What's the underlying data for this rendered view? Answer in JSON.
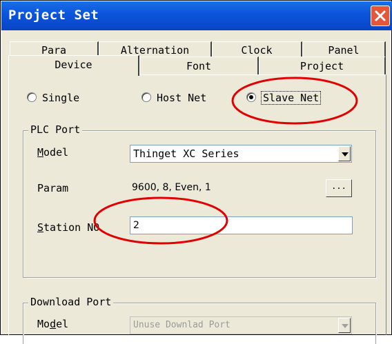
{
  "window": {
    "title": "Project Set",
    "close_icon": "close-icon"
  },
  "tabs_row1": [
    "Para",
    "Alternation",
    "Clock",
    "Panel"
  ],
  "tabs_row2": [
    "Device",
    "Font",
    "Project"
  ],
  "active_tab": "Device",
  "mode": {
    "options": [
      "Single",
      "Host Net",
      "Slave Net"
    ],
    "selected": "Slave Net"
  },
  "plc_port": {
    "group_title": "PLC Port",
    "model_label_u": "M",
    "model_label_rest": "odel",
    "model_value": "Thinget XC Series",
    "param_label": "Param",
    "param_value": "9600, 8, Even, 1",
    "param_button": "...",
    "station_label_u": "S",
    "station_label_rest": "tation NO",
    "station_value": "2"
  },
  "download_port": {
    "group_title": "Download Port",
    "model_label_pre": "Mo",
    "model_label_u": "d",
    "model_label_rest": "el",
    "model_value": "Unuse Downlad Port"
  },
  "colors": {
    "titlebar": "#0b54da",
    "dialog_bg": "#ece9d8",
    "highlight_circle": "#e00000",
    "close_button": "#e3573a"
  }
}
